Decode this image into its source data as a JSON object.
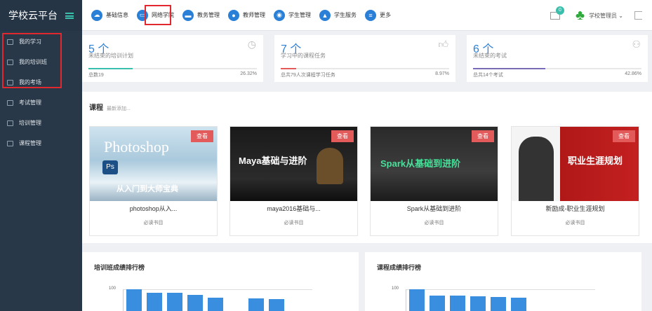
{
  "brand": {
    "title": "学校云平台"
  },
  "sidebar": {
    "items": [
      {
        "label": "我的学习"
      },
      {
        "label": "我的培训班"
      },
      {
        "label": "我的考场"
      },
      {
        "label": "考试管理"
      },
      {
        "label": "培训管理"
      },
      {
        "label": "课程管理"
      }
    ]
  },
  "topnav": {
    "items": [
      {
        "label": "基础信息"
      },
      {
        "label": "网络学院"
      },
      {
        "label": "教务管理"
      },
      {
        "label": "教师管理"
      },
      {
        "label": "学生管理"
      },
      {
        "label": "学生服务"
      },
      {
        "label": "更多"
      }
    ]
  },
  "header": {
    "mail_count": "0",
    "user": "学校管理员"
  },
  "stats": [
    {
      "count": "5 个",
      "label": "未结束的培训计划",
      "footer": "总数19",
      "percent": "26.32%",
      "progress": 0.2632,
      "color": "#3bbfad"
    },
    {
      "count": "7 个",
      "label": "学习中的课程任务",
      "footer": "总共79人次课程学习任务",
      "percent": "8.97%",
      "progress": 0.0897,
      "color": "#e25a5a"
    },
    {
      "count": "6 个",
      "label": "未结束的考试",
      "footer": "总共14个考试",
      "percent": "42.86%",
      "progress": 0.4286,
      "color": "#7a6bb6"
    }
  ],
  "courses_section": {
    "title": "课程",
    "subtitle": "最新添加..."
  },
  "courses": [
    {
      "name": "photoshop从入...",
      "tag": "必读书目",
      "view": "查看",
      "img_title": "Photoshop",
      "img_sub": "从入门到大师宝典"
    },
    {
      "name": "maya2016基础与...",
      "tag": "必读书目",
      "view": "查看",
      "img_title": "Maya基础与进阶"
    },
    {
      "name": "Spark从基础到进阶",
      "tag": "必读书目",
      "view": "查看",
      "img_title": "Spark从基础到进阶"
    },
    {
      "name": "新励成-职业生涯规划",
      "tag": "必读书目",
      "view": "查看",
      "img_title": "职业生涯规划"
    }
  ],
  "rankings": [
    {
      "title": "培训班成绩排行榜",
      "tick": "100",
      "values": [
        100,
        85,
        84,
        73,
        62,
        0,
        58,
        55
      ]
    },
    {
      "title": "课程成绩排行榜",
      "tick": "100",
      "values": [
        100,
        72,
        70,
        68,
        63,
        60
      ]
    }
  ],
  "colors": {
    "sidebar": "#283848",
    "accent": "#2a7fd6",
    "highlight_box": "#e0282e"
  }
}
